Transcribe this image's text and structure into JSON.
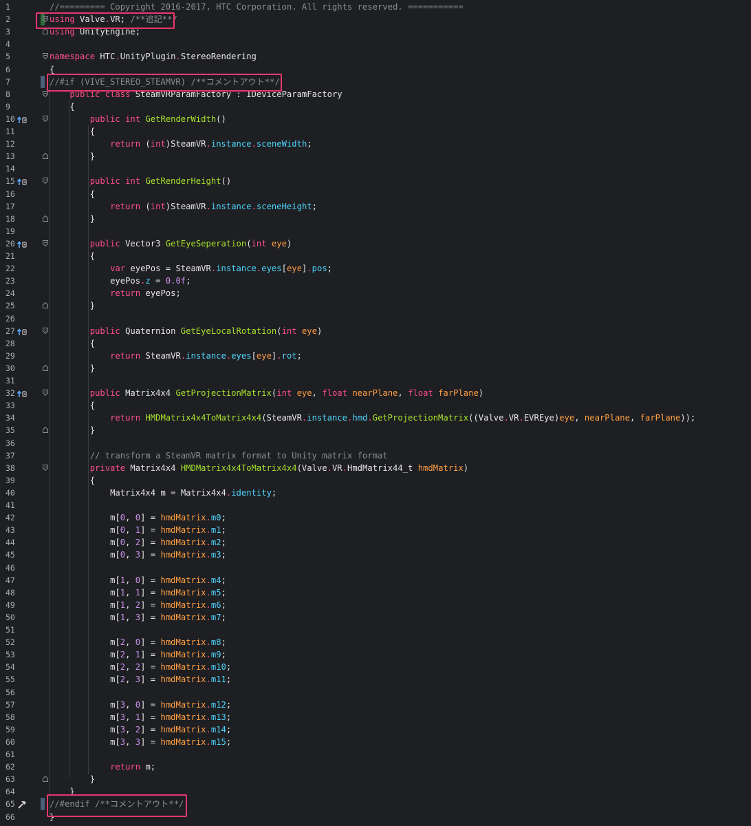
{
  "editor": {
    "colors": {
      "keyword": "#ff4f8b",
      "function": "#a6e22e",
      "property": "#4fd6ff",
      "parameter": "#ff9f43",
      "number": "#c792ea",
      "comment": "#8b8e94",
      "highlight": "#e8386d",
      "changed": "#2f6b3b"
    },
    "lines": [
      {
        "n": "1",
        "code": "//========= Copyright 2016-2017, HTC Corporation. All rights reserved. ==========="
      },
      {
        "n": "2",
        "code": "using Valve.VR; /**追記**/"
      },
      {
        "n": "3",
        "code": "using UnityEngine;"
      },
      {
        "n": "4",
        "code": ""
      },
      {
        "n": "5",
        "code": "namespace HTC.UnityPlugin.StereoRendering"
      },
      {
        "n": "6",
        "code": "{"
      },
      {
        "n": "7",
        "code": "//#if (VIVE_STEREO_STEAMVR) /**コメントアウト**/"
      },
      {
        "n": "8",
        "code": "    public class SteamVRParamFactory : IDeviceParamFactory"
      },
      {
        "n": "9",
        "code": "    {"
      },
      {
        "n": "10",
        "code": "        public int GetRenderWidth()"
      },
      {
        "n": "11",
        "code": "        {"
      },
      {
        "n": "12",
        "code": "            return (int)SteamVR.instance.sceneWidth;"
      },
      {
        "n": "13",
        "code": "        }"
      },
      {
        "n": "14",
        "code": ""
      },
      {
        "n": "15",
        "code": "        public int GetRenderHeight()"
      },
      {
        "n": "16",
        "code": "        {"
      },
      {
        "n": "17",
        "code": "            return (int)SteamVR.instance.sceneHeight;"
      },
      {
        "n": "18",
        "code": "        }"
      },
      {
        "n": "19",
        "code": ""
      },
      {
        "n": "20",
        "code": "        public Vector3 GetEyeSeperation(int eye)"
      },
      {
        "n": "21",
        "code": "        {"
      },
      {
        "n": "22",
        "code": "            var eyePos = SteamVR.instance.eyes[eye].pos;"
      },
      {
        "n": "23",
        "code": "            eyePos.z = 0.0f;"
      },
      {
        "n": "24",
        "code": "            return eyePos;"
      },
      {
        "n": "25",
        "code": "        }"
      },
      {
        "n": "26",
        "code": ""
      },
      {
        "n": "27",
        "code": "        public Quaternion GetEyeLocalRotation(int eye)"
      },
      {
        "n": "28",
        "code": "        {"
      },
      {
        "n": "29",
        "code": "            return SteamVR.instance.eyes[eye].rot;"
      },
      {
        "n": "30",
        "code": "        }"
      },
      {
        "n": "31",
        "code": ""
      },
      {
        "n": "32",
        "code": "        public Matrix4x4 GetProjectionMatrix(int eye, float nearPlane, float farPlane)"
      },
      {
        "n": "33",
        "code": "        {"
      },
      {
        "n": "34",
        "code": "            return HMDMatrix4x4ToMatrix4x4(SteamVR.instance.hmd.GetProjectionMatrix((Valve.VR.EVREye)eye, nearPlane, farPlane));"
      },
      {
        "n": "35",
        "code": "        }"
      },
      {
        "n": "36",
        "code": ""
      },
      {
        "n": "37",
        "code": "        // transform a SteamVR matrix format to Unity matrix format"
      },
      {
        "n": "38",
        "code": "        private Matrix4x4 HMDMatrix4x4ToMatrix4x4(Valve.VR.HmdMatrix44_t hmdMatrix)"
      },
      {
        "n": "39",
        "code": "        {"
      },
      {
        "n": "40",
        "code": "            Matrix4x4 m = Matrix4x4.identity;"
      },
      {
        "n": "41",
        "code": ""
      },
      {
        "n": "42",
        "code": "            m[0, 0] = hmdMatrix.m0;"
      },
      {
        "n": "43",
        "code": "            m[0, 1] = hmdMatrix.m1;"
      },
      {
        "n": "44",
        "code": "            m[0, 2] = hmdMatrix.m2;"
      },
      {
        "n": "45",
        "code": "            m[0, 3] = hmdMatrix.m3;"
      },
      {
        "n": "46",
        "code": ""
      },
      {
        "n": "47",
        "code": "            m[1, 0] = hmdMatrix.m4;"
      },
      {
        "n": "48",
        "code": "            m[1, 1] = hmdMatrix.m5;"
      },
      {
        "n": "49",
        "code": "            m[1, 2] = hmdMatrix.m6;"
      },
      {
        "n": "50",
        "code": "            m[1, 3] = hmdMatrix.m7;"
      },
      {
        "n": "51",
        "code": ""
      },
      {
        "n": "52",
        "code": "            m[2, 0] = hmdMatrix.m8;"
      },
      {
        "n": "53",
        "code": "            m[2, 1] = hmdMatrix.m9;"
      },
      {
        "n": "54",
        "code": "            m[2, 2] = hmdMatrix.m10;"
      },
      {
        "n": "55",
        "code": "            m[2, 3] = hmdMatrix.m11;"
      },
      {
        "n": "56",
        "code": ""
      },
      {
        "n": "57",
        "code": "            m[3, 0] = hmdMatrix.m12;"
      },
      {
        "n": "58",
        "code": "            m[3, 1] = hmdMatrix.m13;"
      },
      {
        "n": "59",
        "code": "            m[3, 2] = hmdMatrix.m14;"
      },
      {
        "n": "60",
        "code": "            m[3, 3] = hmdMatrix.m15;"
      },
      {
        "n": "61",
        "code": ""
      },
      {
        "n": "62",
        "code": "            return m;"
      },
      {
        "n": "63",
        "code": "        }"
      },
      {
        "n": "64",
        "code": "    }"
      },
      {
        "n": "65",
        "code": "//#endif /**コメントアウト**/"
      },
      {
        "n": "66",
        "code": "}"
      }
    ]
  }
}
